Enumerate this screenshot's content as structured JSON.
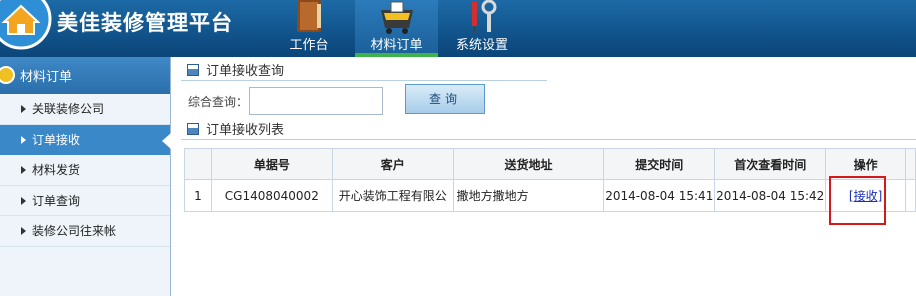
{
  "app": {
    "title": "美佳装修管理平台"
  },
  "nav": {
    "items": [
      {
        "label": "工作台",
        "icon": "book-icon"
      },
      {
        "label": "材料订单",
        "icon": "cart-icon",
        "active": true
      },
      {
        "label": "系统设置",
        "icon": "tools-icon"
      }
    ]
  },
  "sidebar": {
    "header": "材料订单",
    "items": [
      {
        "label": "关联装修公司"
      },
      {
        "label": "订单接收",
        "active": true
      },
      {
        "label": "材料发货"
      },
      {
        "label": "订单查询"
      },
      {
        "label": "装修公司往来帐"
      }
    ]
  },
  "query": {
    "section_title": "订单接收查询",
    "label": "综合查询：",
    "input_value": "",
    "button_label": "查询"
  },
  "list": {
    "section_title": "订单接收列表",
    "columns": [
      "",
      "单据号",
      "客户",
      "送货地址",
      "提交时间",
      "首次查看时间",
      "操作",
      ""
    ],
    "rows": [
      {
        "index": "1",
        "order_no": "CG1408040002",
        "customer": "开心装饰工程有限公",
        "address": "撒地方撒地方",
        "submit_time": "2014-08-04 15:41",
        "first_view_time": "2014-08-04 15:42",
        "action": "[接收]"
      }
    ]
  },
  "colors": {
    "header_bg": "#125a94",
    "active_nav_underline": "#3fb24a",
    "sidebar_active": "#3b88c8",
    "highlight_border": "#d21a1a",
    "link": "#1a2fb5"
  }
}
